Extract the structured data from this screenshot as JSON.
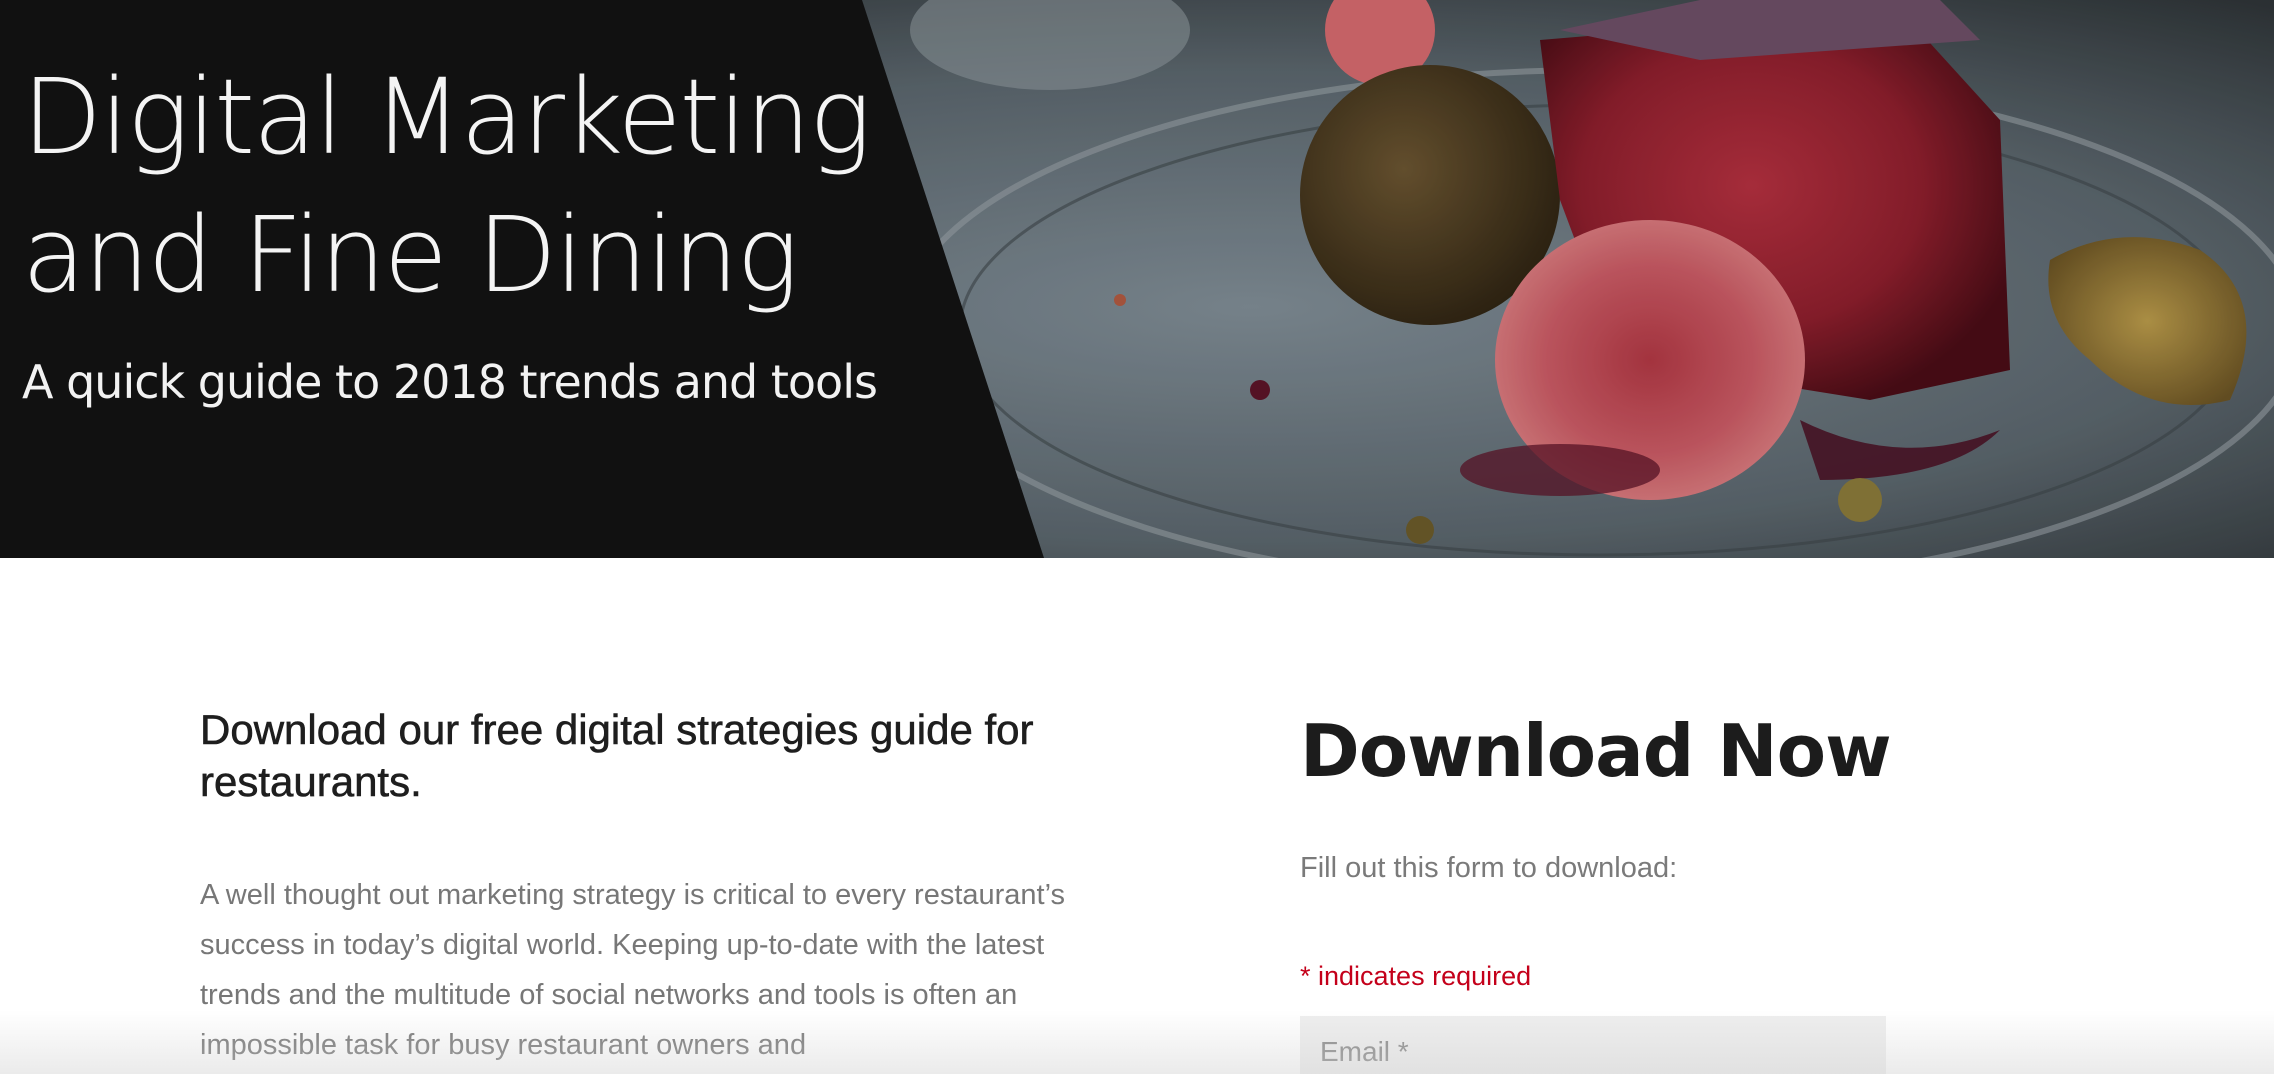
{
  "hero": {
    "title_line1": "Digital Marketing",
    "title_line2": "and Fine Dining",
    "subtitle": "A quick guide to 2018 trends and tools",
    "image": "fine-dining-dessert-photo"
  },
  "guide": {
    "heading": "Download our free digital strategies guide for restaurants.",
    "body": "A well thought out marketing strategy is critical to every restaurant’s success in today’s digital world. Keeping up-to-date with the latest trends and the multitude of social networks and tools is often an impossible task for busy restaurant owners and"
  },
  "form": {
    "title": "Download Now",
    "intro": "Fill out this form to download:",
    "required_note": "* indicates required",
    "email_placeholder": "Email *"
  },
  "colors": {
    "hero_panel": "#111111",
    "required": "#c4001a",
    "input_bg": "#eeeeee"
  }
}
